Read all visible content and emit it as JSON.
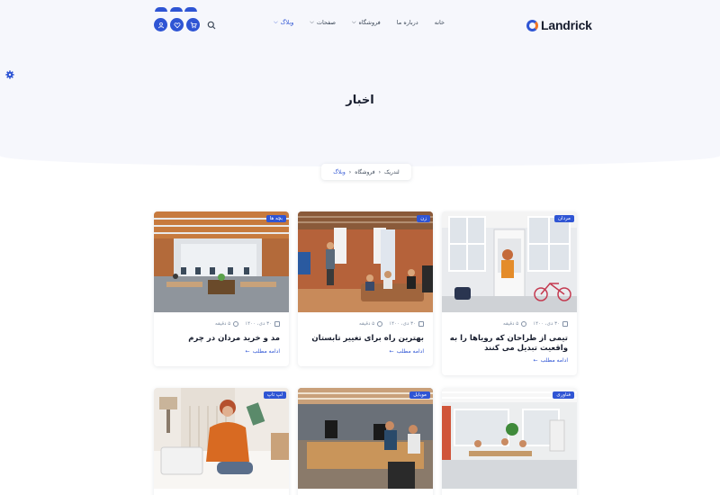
{
  "brand": {
    "name": "Landrick"
  },
  "nav": {
    "items": [
      {
        "label": "خانه",
        "chevron": false,
        "active": false
      },
      {
        "label": "درباره ما",
        "chevron": false,
        "active": false
      },
      {
        "label": "فروشگاه",
        "chevron": true,
        "active": false
      },
      {
        "label": "صفحات",
        "chevron": true,
        "active": false
      },
      {
        "label": "وبلاگ",
        "chevron": true,
        "active": true
      }
    ],
    "icons": [
      "user-icon",
      "heart-icon",
      "cart-icon",
      "search-icon"
    ]
  },
  "page": {
    "title": "اخبار"
  },
  "breadcrumb": {
    "items": [
      "لندریک",
      "فروشگاه"
    ],
    "current": "وبلاگ"
  },
  "posts": [
    {
      "tag": "مردان",
      "date": "۳۰ دی، ۱۴۰۰",
      "read_time": "۵ دقیقه",
      "title": "تیمی از طراحان که رویاها را به واقعیت تبدیل می کنند",
      "more": "ادامه مطلب"
    },
    {
      "tag": "زن",
      "date": "۳۰ دی، ۱۴۰۰",
      "read_time": "۵ دقیقه",
      "title": "بهترین راه برای تغییر تابستان",
      "more": "ادامه مطلب"
    },
    {
      "tag": "بچه ها",
      "date": "۳۰ دی، ۱۴۰۰",
      "read_time": "۵ دقیقه",
      "title": "مد و خرید مردان در چرم",
      "more": "ادامه مطلب"
    },
    {
      "tag": "فناوری"
    },
    {
      "tag": "موبایل"
    },
    {
      "tag": "لپ تاپ"
    }
  ],
  "colors": {
    "primary": "#2f55d4",
    "hero_bg": "#f6f7fc",
    "text": "#161c2d",
    "muted": "#8492a6"
  }
}
